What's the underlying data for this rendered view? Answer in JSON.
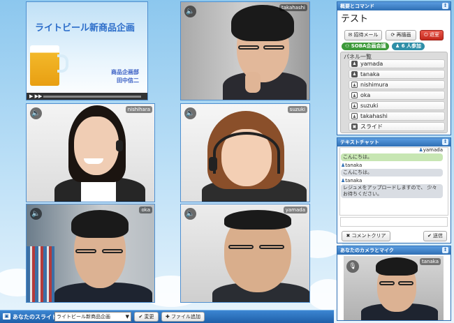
{
  "slide": {
    "title": "ライトビール新商品企画",
    "dept": "商品企画部",
    "presenter": "田中信二"
  },
  "tiles": {
    "takahashi": "takahashi",
    "nishihara": "nishihara",
    "suzuki": "suzuki",
    "oka": "oka",
    "yamada": "yamada"
  },
  "overview": {
    "header": "概要とコマンド",
    "meeting_title": "テスト",
    "invite_label": "招待メール",
    "redraw_label": "再描画",
    "leave_label": "退室",
    "group_label": "SOBA企画会議",
    "participants_label": "6 人参加",
    "panel_list_label": "パネル一覧",
    "panels": [
      "yamada",
      "tanaka",
      "nishimura",
      "oka",
      "suzuki",
      "takahashi",
      "スライド"
    ]
  },
  "chat": {
    "header": "テキストチャット",
    "messages": [
      {
        "sender": "yamada",
        "text": "こんにちは。"
      },
      {
        "sender": "tanaka",
        "text": "こんにちは。"
      },
      {
        "sender": "tanaka",
        "text": "レジュメをアップロードしますので、 少々お待ちください。"
      }
    ],
    "clear_label": "コメントクリア",
    "send_label": "送信"
  },
  "camera": {
    "header": "あなたのカメラとマイク",
    "name": "tanaka"
  },
  "bottom": {
    "label": "あなたのスライド",
    "selected": "ライトビール新商品企画",
    "change_label": "変更",
    "add_file_label": "ファイル追加"
  },
  "colors": {
    "accent": "#2f6fb4",
    "leave_red": "#d93b2f",
    "group_green": "#3d9a3a",
    "chat_green": "#c7e6b3",
    "chat_gray": "#d9dde3"
  }
}
